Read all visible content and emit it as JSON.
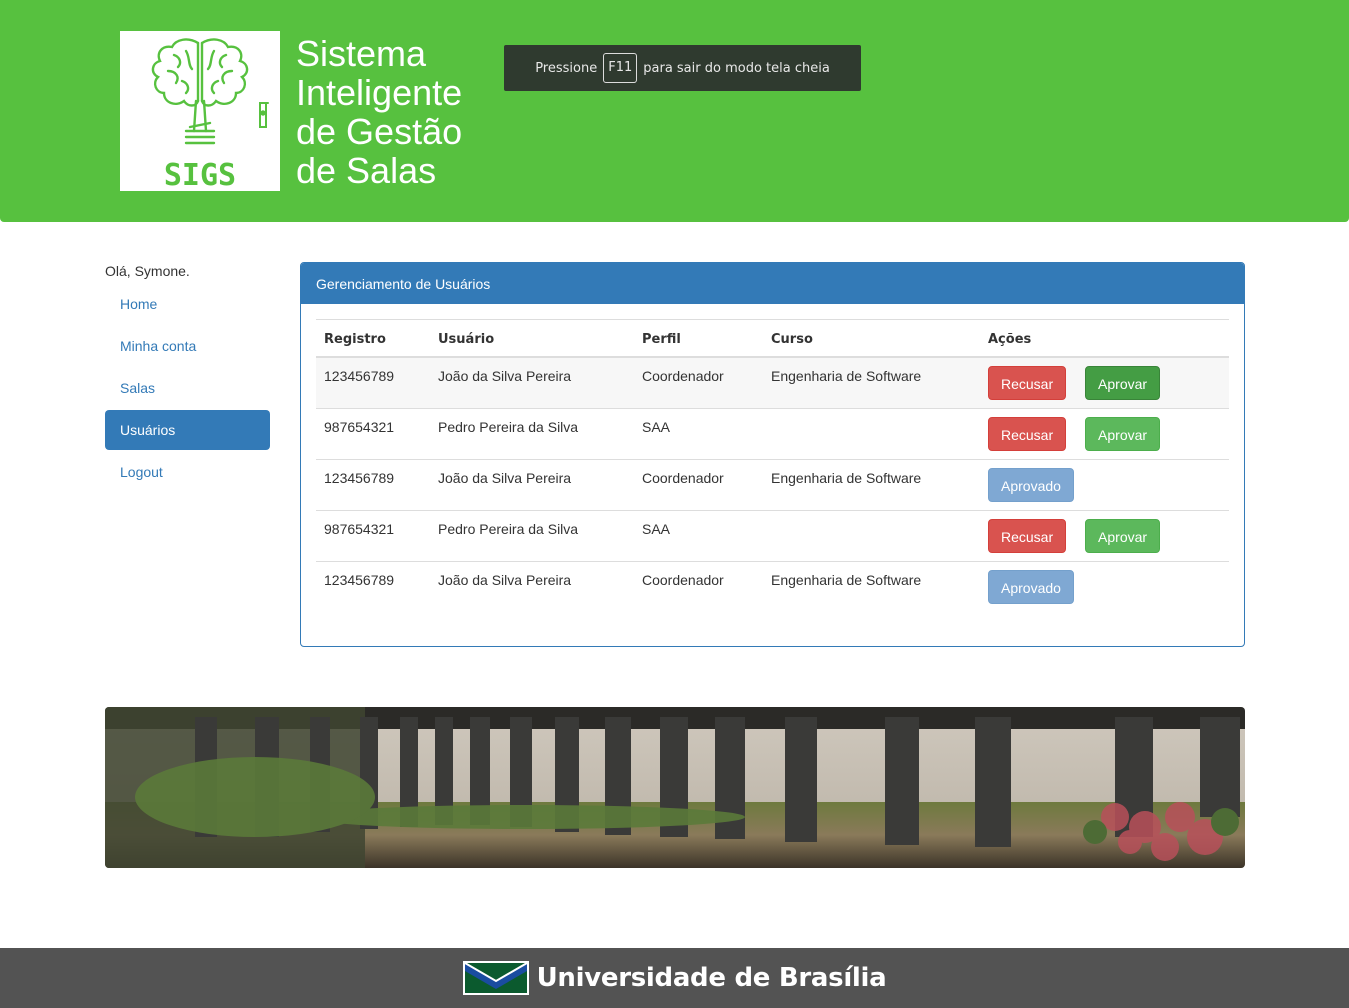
{
  "header": {
    "logo_text": "SIGS",
    "title_lines": [
      "Sistema",
      "Inteligente",
      "de Gestão",
      "de Salas"
    ],
    "fullscreen_notice": {
      "before": "Pressione",
      "key": "F11",
      "after": "para sair do modo tela cheia"
    }
  },
  "sidebar": {
    "greeting": "Olá, Symone.",
    "items": [
      {
        "label": "Home",
        "active": false
      },
      {
        "label": "Minha conta",
        "active": false
      },
      {
        "label": "Salas",
        "active": false
      },
      {
        "label": "Usuários",
        "active": true
      },
      {
        "label": "Logout",
        "active": false
      }
    ]
  },
  "panel": {
    "title": "Gerenciamento de Usuários",
    "columns": [
      "Registro",
      "Usuário",
      "Perfil",
      "Curso",
      "Ações"
    ],
    "rows": [
      {
        "registro": "123456789",
        "usuario": "João da Silva Pereira",
        "perfil": "Coordenador",
        "curso": "Engenharia de Software",
        "status": "pending"
      },
      {
        "registro": "987654321",
        "usuario": "Pedro Pereira da Silva",
        "perfil": "SAA",
        "curso": "",
        "status": "pending"
      },
      {
        "registro": "123456789",
        "usuario": "João da Silva Pereira",
        "perfil": "Coordenador",
        "curso": "Engenharia de Software",
        "status": "approved"
      },
      {
        "registro": "987654321",
        "usuario": "Pedro Pereira da Silva",
        "perfil": "SAA",
        "curso": "",
        "status": "pending"
      },
      {
        "registro": "123456789",
        "usuario": "João da Silva Pereira",
        "perfil": "Coordenador",
        "curso": "Engenharia de Software",
        "status": "approved"
      }
    ],
    "buttons": {
      "refuse": "Recusar",
      "approve": "Aprovar",
      "approved": "Aprovado"
    }
  },
  "footer": {
    "university": "Universidade de Brasília"
  },
  "colors": {
    "header_green": "#57c13f",
    "primary_blue": "#337ab7",
    "danger_red": "#d9534f",
    "success_green": "#5cb85c",
    "footer_gray": "#535353"
  }
}
